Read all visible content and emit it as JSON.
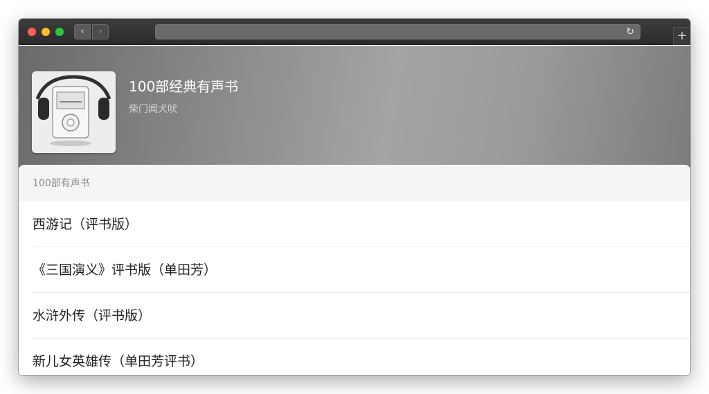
{
  "window": {
    "back_icon": "chevron-left-icon",
    "forward_icon": "chevron-right-icon",
    "reload_icon": "reload-icon",
    "new_tab_icon": "plus-icon",
    "back_glyph": "‹",
    "forward_glyph": "›",
    "reload_glyph": "↻",
    "new_tab_glyph": "+"
  },
  "album": {
    "title": "100部经典有声书",
    "author": "柴门闻犬吠",
    "cover_icon": "mp3-player-headphones-artwork"
  },
  "list": {
    "section_title": "100部有声书",
    "items": [
      {
        "label": "西游记（评书版）"
      },
      {
        "label": "《三国演义》评书版（单田芳）"
      },
      {
        "label": "水浒外传（评书版）"
      },
      {
        "label": "新儿女英雄传（单田芳评书）"
      }
    ]
  },
  "colors": {
    "traffic_red": "#fe5f57",
    "traffic_yellow": "#febb2e",
    "traffic_green": "#29c840"
  }
}
